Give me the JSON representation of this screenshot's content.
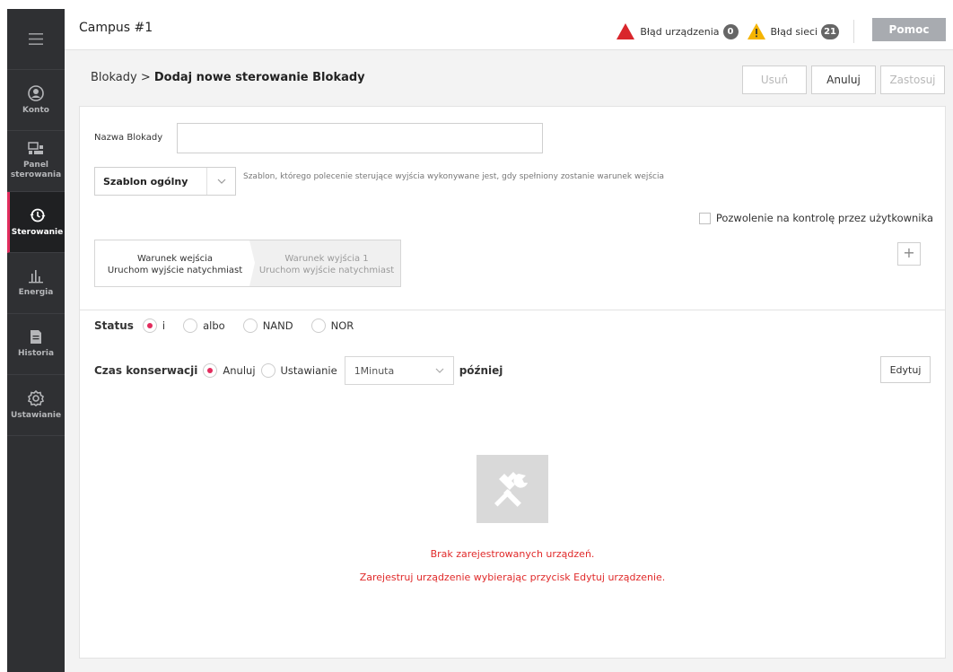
{
  "sidebar": {
    "items": [
      {
        "label": "Konto",
        "icon": "user-icon"
      },
      {
        "label": "Panel sterowania",
        "icon": "dashboard-icon"
      },
      {
        "label": "Sterowanie",
        "icon": "control-icon",
        "active": true
      },
      {
        "label": "Energia",
        "icon": "energy-chart-icon"
      },
      {
        "label": "Historia",
        "icon": "history-icon"
      },
      {
        "label": "Ustawianie",
        "icon": "gear-icon"
      }
    ]
  },
  "header": {
    "title": "Campus #1",
    "device_error_label": "Błąd urządzenia",
    "device_error_count": "0",
    "network_error_label": "Błąd sieci",
    "network_error_count": "21",
    "help_label": "Pomoc"
  },
  "breadcrumb": {
    "parent": "Blokady",
    "separator": " > ",
    "current": "Dodaj nowe sterowanie Blokady"
  },
  "actions": {
    "delete_label": "Usuń",
    "cancel_label": "Anuluj",
    "apply_label": "Zastosuj"
  },
  "form": {
    "name_label": "Nazwa Blokady",
    "name_value": "",
    "template_value": "Szablon ogólny",
    "template_description": "Szablon, którego polecenie sterujące wyjścia wykonywane jest, gdy spełniony zostanie warunek wejścia",
    "permission_label": "Pozwolenie na kontrolę przez użytkownika",
    "steps": [
      {
        "title": "Warunek wejścia",
        "subtitle": "Uruchom wyjście natychmiast"
      },
      {
        "title": "Warunek wyjścia 1",
        "subtitle": "Uruchom wyjście natychmiast"
      }
    ],
    "add_step_label": "+"
  },
  "status": {
    "label": "Status",
    "options": [
      "i",
      "albo",
      "NAND",
      "NOR"
    ],
    "selected": "i"
  },
  "maintenance": {
    "label": "Czas konserwacji",
    "cancel_option": "Anuluj",
    "setting_option": "Ustawianie",
    "selected": "Anuluj",
    "duration_value": "1Minuta",
    "suffix": "później",
    "edit_label": "Edytuj"
  },
  "empty_state": {
    "icon": "tools-icon",
    "line1": "Brak zarejestrowanych urządzeń.",
    "line2": "Zarejestruj urządzenie wybierając przycisk Edytuj urządzenie."
  },
  "colors": {
    "accent": "#e22c5d",
    "sidebar_bg": "#2f3033",
    "error_text": "#e02a2a",
    "help_button": "#a8abb0"
  }
}
